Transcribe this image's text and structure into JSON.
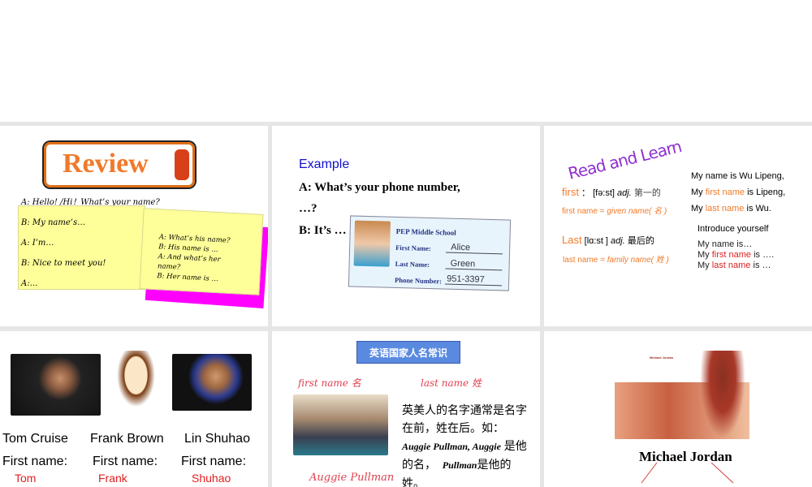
{
  "slide1": {
    "title": "Review",
    "line0": "A: Hello! /Hi！What’s your name?",
    "note1": [
      "B: My name’s…",
      "A: I’m…",
      "B: Nice to meet you!",
      "A:…"
    ],
    "note2": [
      "A: What’s his name?",
      "B: His name is …",
      "A: And what’s her name?",
      "B: Her name is …"
    ]
  },
  "slide2": {
    "heading": "Example",
    "q": "A: What’s your phone number,",
    "q2": "…?",
    "a": "B: It’s …",
    "card": {
      "school": "PEP Middle School",
      "first_label": "First Name:",
      "first": "Alice",
      "last_label": "Last Name:",
      "last": "Green",
      "phone_label": "Phone Number:",
      "phone": "951-3397"
    }
  },
  "slide3": {
    "title": "Read and Learn",
    "first_word": "first",
    "first_colon": "：",
    "first_pron": "[fə:st]",
    "first_adj": "adj.",
    "first_cn": "第一的",
    "first_eq": "first name = ",
    "first_eq2": "given name( 名 )",
    "last_word": "Last",
    "last_pron": "[lɑ:st ]",
    "last_adj": "adj.",
    "last_cn": "最后的",
    "last_eq": "last name = ",
    "last_eq2": "family name( 姓 )",
    "r1": "My name is Wu Lipeng,",
    "r2a": "My ",
    "r2b": "first name",
    "r2c": " is Lipeng,",
    "r3a": "My ",
    "r3b": "last name",
    "r3c": " is Wu.",
    "intro": "Introduce yourself",
    "i1": "My name is…",
    "i2a": "My ",
    "i2b": "first name",
    "i2c": " is ….",
    "i3a": "My ",
    "i3b": "last name",
    "i3c": " is …"
  },
  "slide4": {
    "people": [
      {
        "name": "Tom Cruise",
        "label": "First name:",
        "first": "Tom"
      },
      {
        "name": "Frank Brown",
        "label": "First name:",
        "first": "Frank"
      },
      {
        "name": "Lin Shuhao",
        "label": "First name:",
        "first": "Shuhao"
      }
    ]
  },
  "slide5": {
    "banner": "英语国家人名常识",
    "first": "first name 名",
    "last": "last name 姓",
    "text1": "英美人的名字通常是名字在前，姓在后。如：",
    "text2": "Auggie Pullman, Auggie",
    "text3": " 是他的名，",
    "text4": "Pullman",
    "text5": "是他的姓。",
    "caption": "Auggie Pullman"
  },
  "slide6": {
    "name": "Michael Jordan",
    "poster_title": "Michael Jordan"
  }
}
